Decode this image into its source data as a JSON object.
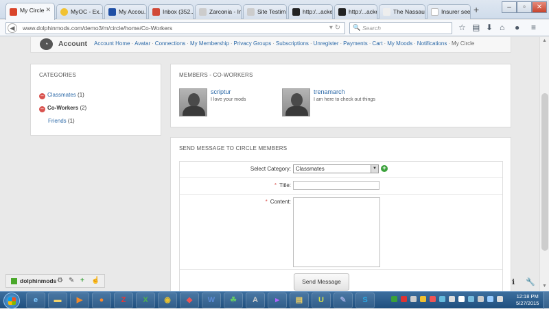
{
  "browser": {
    "tabs": [
      {
        "label": "My Circle",
        "icon": "bars-icon",
        "color": "#d9452b",
        "active": true
      },
      {
        "label": "MyOC - Ex...",
        "icon": "star-icon",
        "color": "#f1c232"
      },
      {
        "label": "My Accou...",
        "icon": "paypal-icon",
        "color": "#1f4fa5"
      },
      {
        "label": "Inbox (352...",
        "icon": "gmail-icon",
        "color": "#d14836"
      },
      {
        "label": "Zarconia - Invo...",
        "icon": "doc-icon",
        "color": "#cccccc"
      },
      {
        "label": "Site Testim...",
        "icon": "doc-icon",
        "color": "#cccccc"
      },
      {
        "label": "http:/...acker",
        "icon": "tracker-icon",
        "color": "#222222"
      },
      {
        "label": "http:/...acker",
        "icon": "tracker-icon",
        "color": "#222222"
      },
      {
        "label": "The Nassau Gu...",
        "icon": "blank-icon",
        "color": "#eeeeee"
      },
      {
        "label": "Insurer see...",
        "icon": "blank-icon",
        "color": "#ffffff"
      }
    ],
    "url": "www.dolphinmods.com/demo3/m/circle/home/Co-Workers",
    "search_placeholder": "Search"
  },
  "account_bar": {
    "title": "Account",
    "links": [
      "Account Home",
      "Avatar",
      "Connections",
      "My Membership",
      "Privacy Groups",
      "Subscriptions",
      "Unregister",
      "Payments",
      "Cart",
      "My Moods",
      "Notifications"
    ],
    "current": "My Circle"
  },
  "categories": {
    "heading": "CATEGORIES",
    "items": [
      {
        "label": "Classmates",
        "count": "(1)",
        "removable": true,
        "selected": false
      },
      {
        "label": "Co-Workers",
        "count": "(2)",
        "removable": true,
        "selected": true
      },
      {
        "label": "Friends",
        "count": "(1)",
        "removable": false,
        "selected": false
      }
    ]
  },
  "members": {
    "heading": "MEMBERS - CO-WORKERS",
    "items": [
      {
        "name": "scriptur",
        "bio": "I love your mods"
      },
      {
        "name": "trenamarch",
        "bio": "I am here to check out things"
      }
    ]
  },
  "send_message": {
    "heading": "SEND MESSAGE TO CIRCLE MEMBERS",
    "category_label": "Select Category:",
    "category_value": "Classmates",
    "title_label": "Title:",
    "title_value": "",
    "content_label": "Content:",
    "content_value": "",
    "required_mark": "*",
    "button_label": "Send Message"
  },
  "addon_bar": {
    "label": "dolphinmods"
  },
  "taskbar": {
    "time": "12:18 PM",
    "date": "5/27/2015"
  }
}
